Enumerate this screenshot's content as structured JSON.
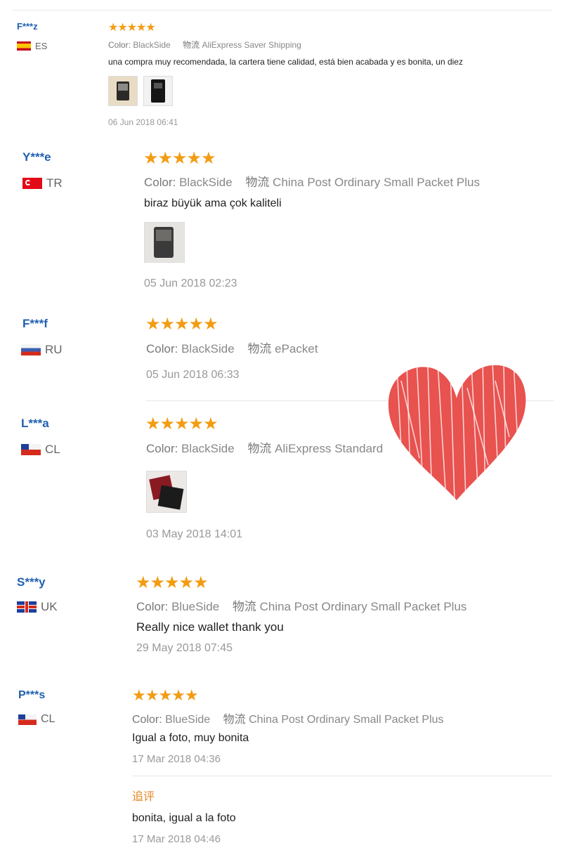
{
  "reviews": [
    {
      "user": "F***z",
      "country": "ES",
      "stars": "★★★★★",
      "color_key": "Color:",
      "color_val": "BlackSide",
      "ship_key": "物流",
      "ship_val": "AliExpress Saver Shipping",
      "text": "una compra muy recomendada, la cartera tiene calidad, está bien acabada y es bonita, un diez",
      "date": "06 Jun 2018 06:41"
    },
    {
      "user": "Y***e",
      "country": "TR",
      "stars": "★★★★★",
      "color_key": "Color:",
      "color_val": "BlackSide",
      "ship_key": "物流",
      "ship_val": "China Post Ordinary Small Packet Plus",
      "text": "biraz büyük ama çok kaliteli",
      "date": "05 Jun 2018 02:23"
    },
    {
      "user": "F***f",
      "country": "RU",
      "stars": "★★★★★",
      "color_key": "Color:",
      "color_val": "BlackSide",
      "ship_key": "物流",
      "ship_val": "ePacket",
      "date": "05 Jun 2018 06:33"
    },
    {
      "user": "L***a",
      "country": "CL",
      "stars": "★★★★★",
      "color_key": "Color:",
      "color_val": "BlackSide",
      "ship_key": "物流",
      "ship_val": "AliExpress Standard",
      "date": "03 May 2018 14:01"
    },
    {
      "user": "S***y",
      "country": "UK",
      "stars": "★★★★★",
      "color_key": "Color:",
      "color_val": "BlueSide",
      "ship_key": "物流",
      "ship_val": "China Post Ordinary Small Packet Plus",
      "text": "Really nice wallet thank you",
      "date": "29 May 2018 07:45"
    },
    {
      "user": "P***s",
      "country": "CL",
      "stars": "★★★★★",
      "color_key": "Color:",
      "color_val": "BlueSide",
      "ship_key": "物流",
      "ship_val": "China Post Ordinary Small Packet Plus",
      "text": "Igual a foto, muy bonita",
      "date": "17 Mar 2018 04:36",
      "additional_label": "追评",
      "additional_text": "bonita, igual a la foto",
      "additional_date": "17 Mar 2018 04:46"
    }
  ],
  "colors": {
    "username": "#2060b0",
    "star": "#f39c12",
    "heart": "#e8524f",
    "additional": "#e6851f"
  }
}
